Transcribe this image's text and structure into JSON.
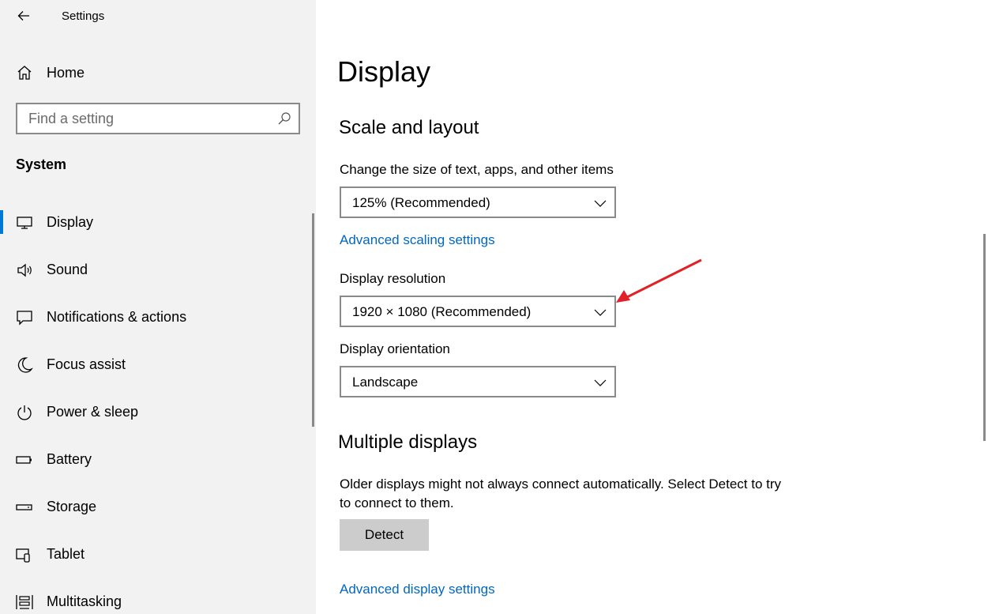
{
  "window": {
    "title": "Settings"
  },
  "sidebar": {
    "home_label": "Home",
    "search": {
      "placeholder": "Find a setting"
    },
    "section": "System",
    "items": [
      {
        "label": "Display",
        "icon": "monitor-icon",
        "active": true
      },
      {
        "label": "Sound",
        "icon": "speaker-icon"
      },
      {
        "label": "Notifications & actions",
        "icon": "notification-icon"
      },
      {
        "label": "Focus assist",
        "icon": "moon-icon"
      },
      {
        "label": "Power & sleep",
        "icon": "power-icon"
      },
      {
        "label": "Battery",
        "icon": "battery-icon"
      },
      {
        "label": "Storage",
        "icon": "storage-icon"
      },
      {
        "label": "Tablet",
        "icon": "tablet-icon"
      },
      {
        "label": "Multitasking",
        "icon": "multitasking-icon"
      }
    ]
  },
  "main": {
    "title": "Display",
    "scale_layout": {
      "heading": "Scale and layout",
      "size_label": "Change the size of text, apps, and other items",
      "size_value": "125% (Recommended)",
      "advanced_scaling_link": "Advanced scaling settings",
      "resolution_label": "Display resolution",
      "resolution_value": "1920 × 1080 (Recommended)",
      "orientation_label": "Display orientation",
      "orientation_value": "Landscape"
    },
    "multiple_displays": {
      "heading": "Multiple displays",
      "description": "Older displays might not always connect automatically. Select Detect to try to connect to them.",
      "detect_label": "Detect",
      "advanced_display_link": "Advanced display settings"
    }
  },
  "colors": {
    "accent": "#0078d7",
    "link": "#0067c0",
    "annotation_arrow": "#e0202a"
  }
}
